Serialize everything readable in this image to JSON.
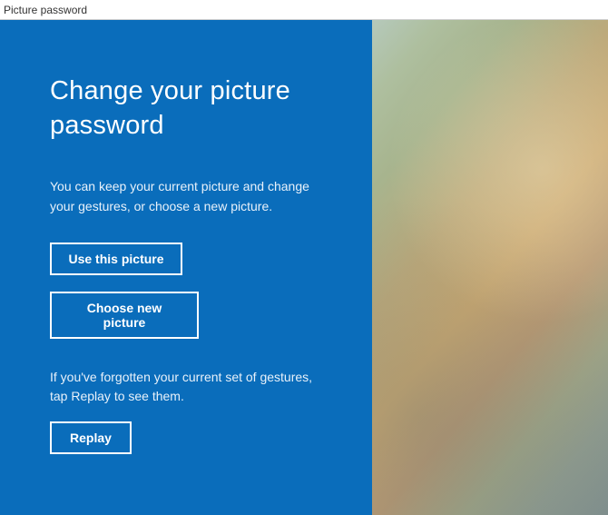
{
  "window": {
    "title": "Picture password"
  },
  "panel": {
    "heading": "Change your picture password",
    "description": "You can keep your current picture and change your gestures, or choose a new picture.",
    "forgot_text": "If you've forgotten your current set of gestures, tap Replay to see them.",
    "buttons": {
      "use_this": "Use this picture",
      "choose_new": "Choose new picture",
      "replay": "Replay"
    }
  }
}
